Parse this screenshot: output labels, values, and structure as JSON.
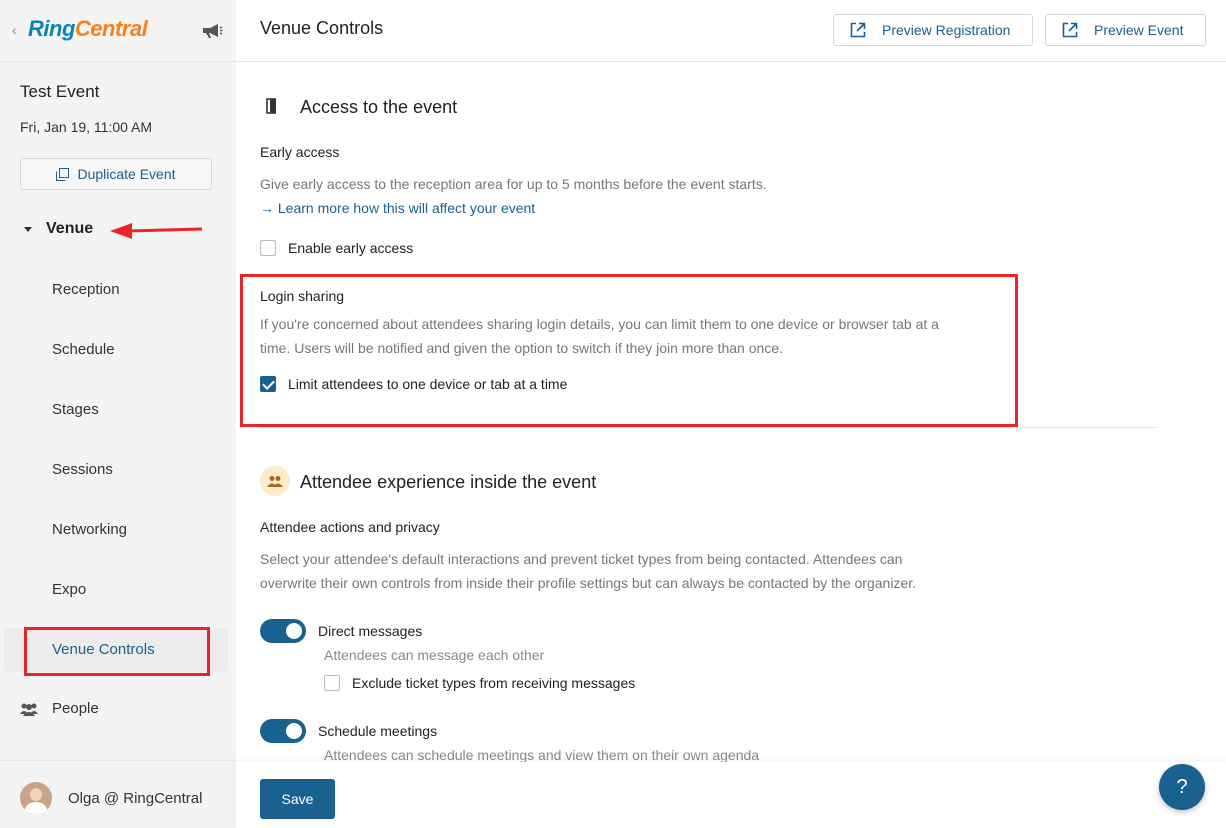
{
  "sidebar": {
    "back_glyph": "‹",
    "logo_ring": "Ring",
    "logo_central": "Central",
    "event_title": "Test Event",
    "event_date": "Fri, Jan 19, 11:00 AM",
    "duplicate_label": "Duplicate Event",
    "venue_label": "Venue",
    "nav_items": [
      {
        "label": "Reception"
      },
      {
        "label": "Schedule"
      },
      {
        "label": "Stages"
      },
      {
        "label": "Sessions"
      },
      {
        "label": "Networking"
      },
      {
        "label": "Expo"
      },
      {
        "label": "Venue Controls",
        "active": true
      }
    ],
    "people_label": "People",
    "user_label": "Olga @ RingCentral"
  },
  "header": {
    "title": "Venue Controls",
    "preview_registration": "Preview Registration",
    "preview_event": "Preview Event"
  },
  "access": {
    "title": "Access to the event",
    "early_access": {
      "title": "Early access",
      "description": "Give early access to the reception area for up to 5 months before the event starts.",
      "link": "→ Learn more how this will affect your event",
      "checkbox_label": "Enable early access",
      "checked": false
    },
    "login_sharing": {
      "title": "Login sharing",
      "description_line1": "If you're concerned about attendees sharing login details, you can limit them to one device or browser tab at a",
      "description_line2": "time. Users will be notified and given the option to switch if they join more than once.",
      "checkbox_label": "Limit attendees to one device or tab at a time",
      "checked": true
    }
  },
  "experience": {
    "title": "Attendee experience inside the event",
    "subtitle": "Attendee actions and privacy",
    "description_line1": "Select your attendee's default interactions and prevent ticket types from being contacted. Attendees can",
    "description_line2": "overwrite their own controls from inside their profile settings but can always be contacted by the organizer.",
    "direct_messages": {
      "label": "Direct messages",
      "description": "Attendees can message each other",
      "exclude_label": "Exclude ticket types from receiving messages",
      "enabled": true
    },
    "schedule_meetings": {
      "label": "Schedule meetings",
      "description": "Attendees can schedule meetings and view them on their own agenda",
      "enabled": true
    }
  },
  "footer": {
    "save_label": "Save",
    "help_label": "?"
  },
  "colors": {
    "accent": "#19618e",
    "annotation_red": "#e8262a",
    "logo_blue": "#0684bc",
    "logo_orange": "#f8801c"
  }
}
